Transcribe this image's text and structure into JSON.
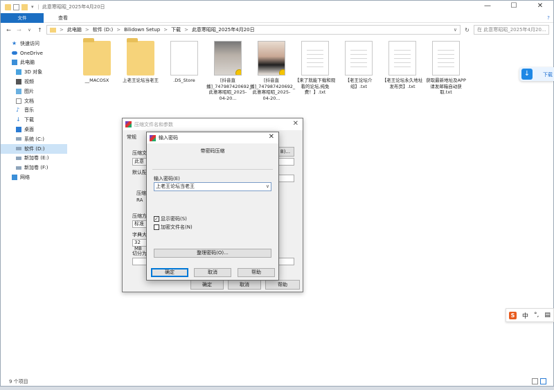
{
  "explorer": {
    "title": "此意寒昭昭_2025年4月20日",
    "ribbon_tabs": [
      "文件",
      "主页",
      "共享",
      "查看"
    ],
    "help": "?",
    "window_controls": [
      "—",
      "☐",
      "✕"
    ],
    "nav_buttons": [
      "←",
      "→",
      "∨",
      "↑"
    ],
    "breadcrumb": [
      "此电脑",
      "软件 (D:)",
      "Bilidown Setup",
      "下载",
      "此意寒昭昭_2025年4月20日"
    ],
    "breadcrumb_sep": ">",
    "address_dropdown": "∨",
    "search_placeholder": "在 此意寒昭昭_2025年4月20...",
    "nav_items": [
      {
        "label": "快速访问",
        "icon": "star-icon"
      },
      {
        "label": "OneDrive",
        "icon": "cloud-icon"
      },
      {
        "label": "此电脑",
        "icon": "computer-icon"
      },
      {
        "label": "3D 对象",
        "icon": "cube-icon"
      },
      {
        "label": "视频",
        "icon": "video-icon"
      },
      {
        "label": "图片",
        "icon": "image-icon"
      },
      {
        "label": "文档",
        "icon": "document-icon"
      },
      {
        "label": "音乐",
        "icon": "music-icon"
      },
      {
        "label": "下载",
        "icon": "download-icon"
      },
      {
        "label": "桌面",
        "icon": "desktop-icon"
      },
      {
        "label": "系统 (C:)",
        "icon": "drive-icon"
      },
      {
        "label": "软件 (D:)",
        "icon": "drive-icon"
      },
      {
        "label": "新加卷 (E:)",
        "icon": "drive-icon"
      },
      {
        "label": "新加卷 (F:)",
        "icon": "drive-icon"
      },
      {
        "label": "网络",
        "icon": "network-icon"
      }
    ],
    "files": [
      {
        "name": "__MACOSX",
        "type": "folder"
      },
      {
        "name": "上老王论坛当老王",
        "type": "folder"
      },
      {
        "name": ".DS_Store",
        "type": "blank"
      },
      {
        "name": "[抖音直播]_747987420692_此意寒昭昭_2025-04-20...",
        "type": "video-a"
      },
      {
        "name": "[抖音直播]_747987420692_此意寒昭昭_2025-04-20...",
        "type": "video-b"
      },
      {
        "name": "【来了就能下载和观看的论坛,纯免费！】.txt",
        "type": "txt"
      },
      {
        "name": "【老王论坛介绍】.txt",
        "type": "txt"
      },
      {
        "name": "【老王论坛永久地址发布页】.txt",
        "type": "txt"
      },
      {
        "name": "获取最新地址及APP请发邮箱自动获取.txt",
        "type": "txt"
      }
    ],
    "status": "9 个项目"
  },
  "compress_dialog": {
    "title": "压缩文件名和参数",
    "tab": "常规",
    "labels": [
      "压缩文",
      "此意",
      "默认配",
      "压缩",
      "RA",
      "压缩方",
      "标准",
      "字典大",
      "32 MB",
      "切分为"
    ],
    "partial_button": "B)...",
    "buttons": [
      "确定",
      "取消",
      "帮助"
    ]
  },
  "password_dialog": {
    "title": "输入密码",
    "subtitle": "带密码压缩",
    "password_label": "输入密码(E)",
    "password_value": "上老王论坛当老王",
    "show_password": "显示密码(S)",
    "show_password_checked": "✓",
    "encrypt_names": "加密文件名(N)",
    "organize_button": "整理密码(O)...",
    "ok": "确定",
    "cancel": "取消",
    "help": "帮助",
    "close": "✕",
    "dropdown": "∨"
  },
  "side_download": {
    "label": "下载",
    "icon": "download-arrow-icon"
  },
  "ime_bar": {
    "logo": "S",
    "lang": "中",
    "punct": "°,",
    "menu": "▤"
  }
}
